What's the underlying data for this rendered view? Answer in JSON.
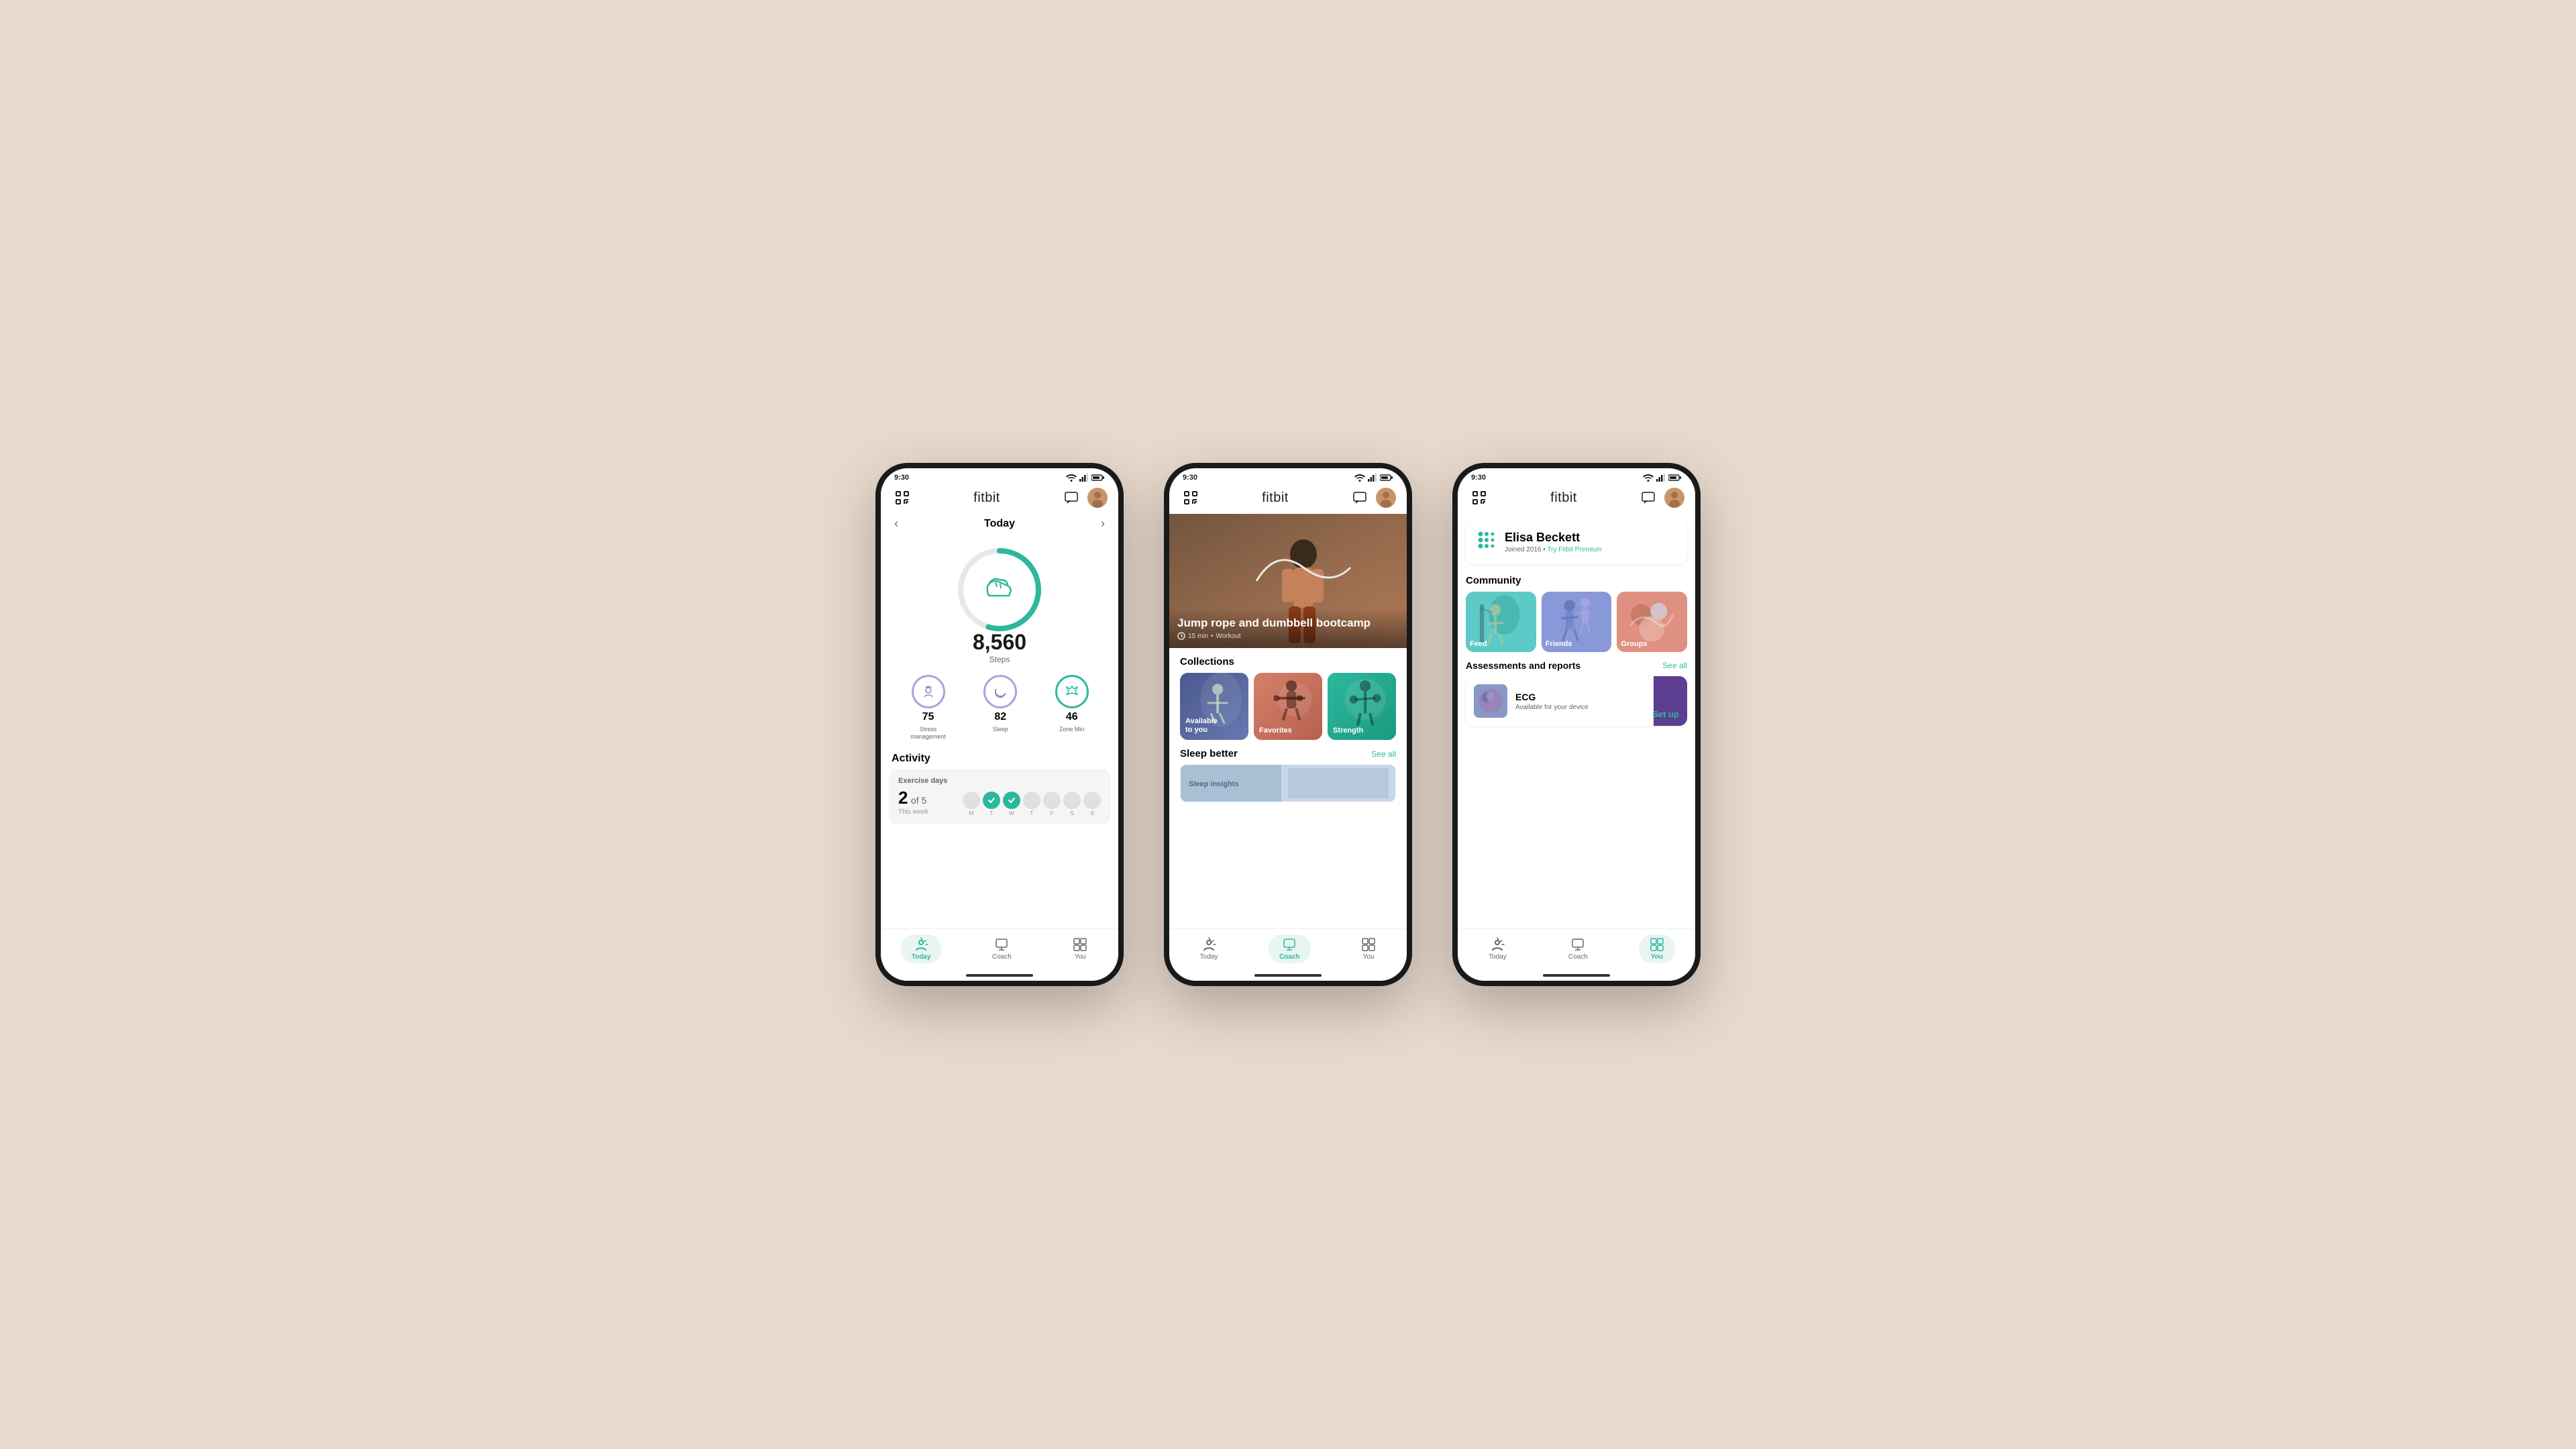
{
  "bg_color": "#e8d9cc",
  "phones": [
    {
      "id": "phone1",
      "status_time": "9:30",
      "app_title": "fitbit",
      "screen": "today",
      "today": {
        "date_label": "Today",
        "steps": "8,560",
        "steps_unit": "Steps",
        "metrics": [
          {
            "value": "75",
            "label": "Stress\nmanagement",
            "icon": "stress",
            "color": "purple"
          },
          {
            "value": "82",
            "label": "Sleep",
            "icon": "sleep",
            "color": "purple"
          },
          {
            "value": "46",
            "label": "Zone Min",
            "icon": "zone",
            "color": "teal"
          }
        ],
        "activity_title": "Activity",
        "exercise_label": "Exercise days",
        "exercise_count": "2",
        "exercise_total": "5",
        "exercise_period": "This week",
        "days": [
          "M",
          "T",
          "W",
          "T",
          "F",
          "S",
          "S"
        ],
        "days_done": [
          0,
          1,
          2
        ]
      },
      "nav": {
        "items": [
          {
            "label": "Today",
            "active": true
          },
          {
            "label": "Coach",
            "active": false
          },
          {
            "label": "You",
            "active": false
          }
        ]
      }
    },
    {
      "id": "phone2",
      "status_time": "9:30",
      "app_title": "fitbit",
      "screen": "coach",
      "coach": {
        "hero_title": "Jump rope and\ndumbbell bootcamp",
        "hero_duration": "15 min",
        "hero_type": "Workout",
        "collections_title": "Collections",
        "collections": [
          {
            "label": "Available\nto you",
            "style": "available"
          },
          {
            "label": "Favorites",
            "style": "favorites"
          },
          {
            "label": "Strength",
            "style": "strength"
          }
        ],
        "sleep_section": "Sleep better",
        "see_all": "See all"
      },
      "nav": {
        "items": [
          {
            "label": "Today",
            "active": false
          },
          {
            "label": "Coach",
            "active": true
          },
          {
            "label": "You",
            "active": false
          }
        ]
      }
    },
    {
      "id": "phone3",
      "status_time": "9:30",
      "app_title": "fitbit",
      "screen": "you",
      "you": {
        "profile_name": "Elisa Beckett",
        "profile_joined": "Joined 2016",
        "profile_premium": "Try Fitbit Premium",
        "community_title": "Community",
        "community_items": [
          {
            "label": "Feed",
            "style": "feed"
          },
          {
            "label": "Friends",
            "style": "friends"
          },
          {
            "label": "Groups",
            "style": "groups"
          }
        ],
        "assessments_title": "Assessments and reports",
        "see_all": "See all",
        "ecg_title": "ECG",
        "ecg_subtitle": "Available for your device",
        "setup_label": "Set up"
      },
      "nav": {
        "items": [
          {
            "label": "Today",
            "active": false
          },
          {
            "label": "Coach",
            "active": false
          },
          {
            "label": "You",
            "active": true
          }
        ]
      }
    }
  ]
}
